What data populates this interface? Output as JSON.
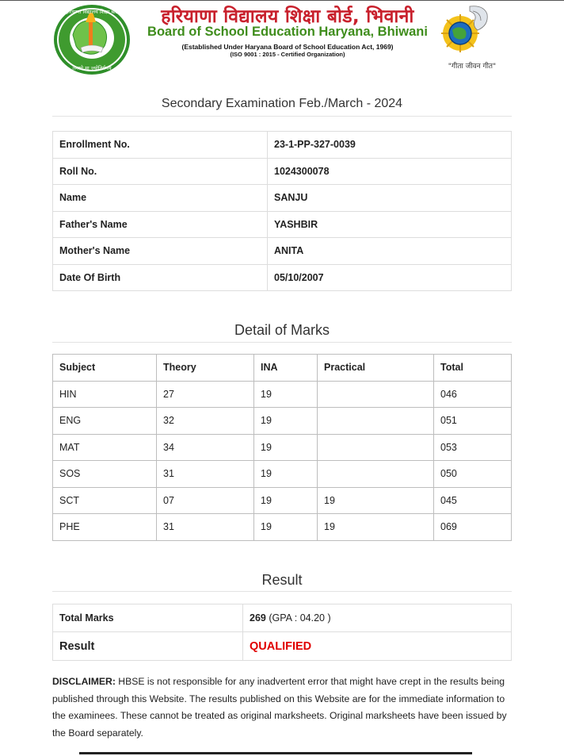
{
  "header": {
    "title_hindi": "हरियाणा विद्यालय शिक्षा बोर्ड, भिवानी",
    "title_english": "Board of School Education Haryana, Bhiwani",
    "subtitle_1": "(Established Under Haryana Board of School Education Act, 1969)",
    "subtitle_2": "(ISO 9001 : 2015 - Certified Organization)",
    "motto": "\"गीता जीवन गीत\"",
    "logo_left_text_top": "हरियाणा विद्यालय शिक्षा बोर्ड",
    "logo_left_text_bottom": "तमसो मा ज्योतिर्गमय"
  },
  "exam_title": "Secondary Examination Feb./March - 2024",
  "student": [
    {
      "label": "Enrollment No.",
      "value": "23-1-PP-327-0039"
    },
    {
      "label": "Roll No.",
      "value": "1024300078"
    },
    {
      "label": "Name",
      "value": "SANJU"
    },
    {
      "label": "Father's Name",
      "value": "YASHBIR"
    },
    {
      "label": "Mother's Name",
      "value": "ANITA"
    },
    {
      "label": "Date Of Birth",
      "value": "05/10/2007"
    }
  ],
  "marks_title": "Detail of Marks",
  "marks": {
    "headers": [
      "Subject",
      "Theory",
      "INA",
      "Practical",
      "Total"
    ],
    "rows": [
      [
        "HIN",
        "27",
        "19",
        "",
        "046"
      ],
      [
        "ENG",
        "32",
        "19",
        "",
        "051"
      ],
      [
        "MAT",
        "34",
        "19",
        "",
        "053"
      ],
      [
        "SOS",
        "31",
        "19",
        "",
        "050"
      ],
      [
        "SCT",
        "07",
        "19",
        "19",
        "045"
      ],
      [
        "PHE",
        "31",
        "19",
        "19",
        "069"
      ]
    ]
  },
  "result_title": "Result",
  "result": {
    "total_label": "Total Marks",
    "total_value": "269",
    "gpa_text": "(GPA : 04.20 )",
    "result_label": "Result",
    "result_value": "QUALIFIED"
  },
  "disclaimer": {
    "label": "DISCLAIMER:",
    "text": " HBSE is not responsible for any inadvertent error that might have crept in the results being published through this Website. The results published on this Website are for the immediate information to the examinees. These cannot be treated as original marksheets. Original marksheets have been issued by the Board separately."
  },
  "colors": {
    "hindi_title": "#c8202c",
    "english_title": "#3f8d1c",
    "qualified": "#e00000"
  }
}
